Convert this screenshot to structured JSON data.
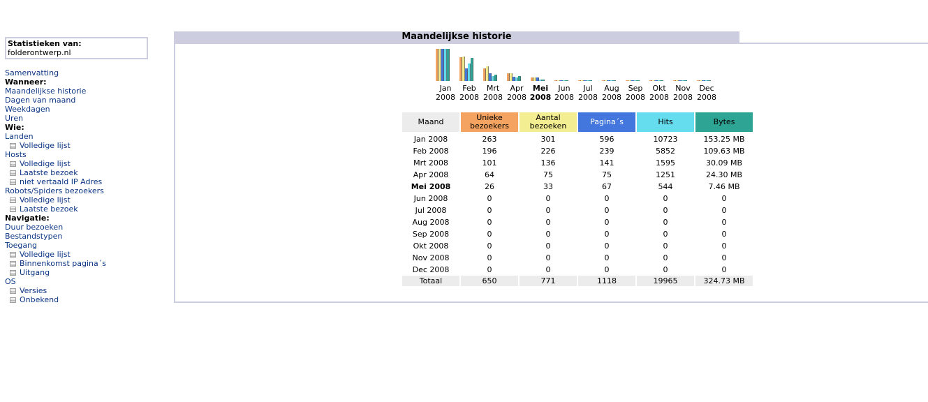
{
  "sidebar": {
    "stats_label": "Statistieken van:",
    "site": "folderontwerp.nl",
    "menu": [
      {
        "type": "link",
        "text": "Samenvatting"
      },
      {
        "type": "header",
        "text": "Wanneer:"
      },
      {
        "type": "link",
        "text": "Maandelijkse historie"
      },
      {
        "type": "link",
        "text": "Dagen van maand"
      },
      {
        "type": "link",
        "text": "Weekdagen"
      },
      {
        "type": "link",
        "text": "Uren"
      },
      {
        "type": "header",
        "text": "Wie:"
      },
      {
        "type": "link",
        "text": "Landen"
      },
      {
        "type": "sub",
        "text": "Volledige lijst"
      },
      {
        "type": "link",
        "text": "Hosts"
      },
      {
        "type": "sub",
        "text": "Volledige lijst"
      },
      {
        "type": "sub",
        "text": "Laatste bezoek"
      },
      {
        "type": "sub",
        "text": "niet vertaald IP Adres"
      },
      {
        "type": "link",
        "text": "Robots/Spiders bezoekers"
      },
      {
        "type": "sub",
        "text": "Volledige lijst"
      },
      {
        "type": "sub",
        "text": "Laatste bezoek"
      },
      {
        "type": "header",
        "text": "Navigatie:"
      },
      {
        "type": "link",
        "text": "Duur bezoeken"
      },
      {
        "type": "link",
        "text": "Bestandstypen"
      },
      {
        "type": "link",
        "text": "Toegang"
      },
      {
        "type": "sub",
        "text": "Volledige lijst"
      },
      {
        "type": "sub",
        "text": "Binnenkomst pagina´s"
      },
      {
        "type": "sub",
        "text": "Uitgang"
      },
      {
        "type": "link",
        "text": "OS"
      },
      {
        "type": "sub",
        "text": "Versies"
      },
      {
        "type": "sub",
        "text": "Onbekend"
      }
    ]
  },
  "panel": {
    "title": "Maandelijkse historie"
  },
  "colors": {
    "unieke": "#f4a460",
    "aantal": "#f3ee92",
    "paginas": "#4477dd",
    "hits": "#66ddee",
    "bytes": "#2ea495"
  },
  "table": {
    "headers": [
      "Maand",
      "Unieke bezoekers",
      "Aantal bezoeken",
      "Pagina´s",
      "Hits",
      "Bytes"
    ],
    "rows": [
      {
        "month": "Jan 2008",
        "unieke": "263",
        "aantal": "301",
        "paginas": "596",
        "hits": "10723",
        "bytes": "153.25 MB"
      },
      {
        "month": "Feb 2008",
        "unieke": "196",
        "aantal": "226",
        "paginas": "239",
        "hits": "5852",
        "bytes": "109.63 MB"
      },
      {
        "month": "Mrt 2008",
        "unieke": "101",
        "aantal": "136",
        "paginas": "141",
        "hits": "1595",
        "bytes": "30.09 MB"
      },
      {
        "month": "Apr 2008",
        "unieke": "64",
        "aantal": "75",
        "paginas": "75",
        "hits": "1251",
        "bytes": "24.30 MB"
      },
      {
        "month": "Mei 2008",
        "unieke": "26",
        "aantal": "33",
        "paginas": "67",
        "hits": "544",
        "bytes": "7.46 MB",
        "current": true
      },
      {
        "month": "Jun 2008",
        "unieke": "0",
        "aantal": "0",
        "paginas": "0",
        "hits": "0",
        "bytes": "0"
      },
      {
        "month": "Jul 2008",
        "unieke": "0",
        "aantal": "0",
        "paginas": "0",
        "hits": "0",
        "bytes": "0"
      },
      {
        "month": "Aug 2008",
        "unieke": "0",
        "aantal": "0",
        "paginas": "0",
        "hits": "0",
        "bytes": "0"
      },
      {
        "month": "Sep 2008",
        "unieke": "0",
        "aantal": "0",
        "paginas": "0",
        "hits": "0",
        "bytes": "0"
      },
      {
        "month": "Okt 2008",
        "unieke": "0",
        "aantal": "0",
        "paginas": "0",
        "hits": "0",
        "bytes": "0"
      },
      {
        "month": "Nov 2008",
        "unieke": "0",
        "aantal": "0",
        "paginas": "0",
        "hits": "0",
        "bytes": "0"
      },
      {
        "month": "Dec 2008",
        "unieke": "0",
        "aantal": "0",
        "paginas": "0",
        "hits": "0",
        "bytes": "0"
      }
    ],
    "total": {
      "label": "Totaal",
      "unieke": "650",
      "aantal": "771",
      "paginas": "1118",
      "hits": "19965",
      "bytes": "324.73 MB"
    }
  },
  "chart_data": {
    "type": "bar",
    "categories": [
      "Jan",
      "Feb",
      "Mrt",
      "Apr",
      "Mei",
      "Jun",
      "Jul",
      "Aug",
      "Sep",
      "Okt",
      "Nov",
      "Dec"
    ],
    "year": "2008",
    "current": "Mei",
    "series": [
      {
        "name": "Unieke bezoekers",
        "values": [
          263,
          196,
          101,
          64,
          26,
          0,
          0,
          0,
          0,
          0,
          0,
          0
        ]
      },
      {
        "name": "Aantal bezoeken",
        "values": [
          301,
          226,
          136,
          75,
          33,
          0,
          0,
          0,
          0,
          0,
          0,
          0
        ]
      },
      {
        "name": "Pagina´s",
        "values": [
          596,
          239,
          141,
          75,
          67,
          0,
          0,
          0,
          0,
          0,
          0,
          0
        ]
      },
      {
        "name": "Hits",
        "values": [
          10723,
          5852,
          1595,
          1251,
          544,
          0,
          0,
          0,
          0,
          0,
          0,
          0
        ]
      },
      {
        "name": "Bytes",
        "values": [
          153.25,
          109.63,
          30.09,
          24.3,
          7.46,
          0,
          0,
          0,
          0,
          0,
          0,
          0
        ]
      }
    ]
  }
}
